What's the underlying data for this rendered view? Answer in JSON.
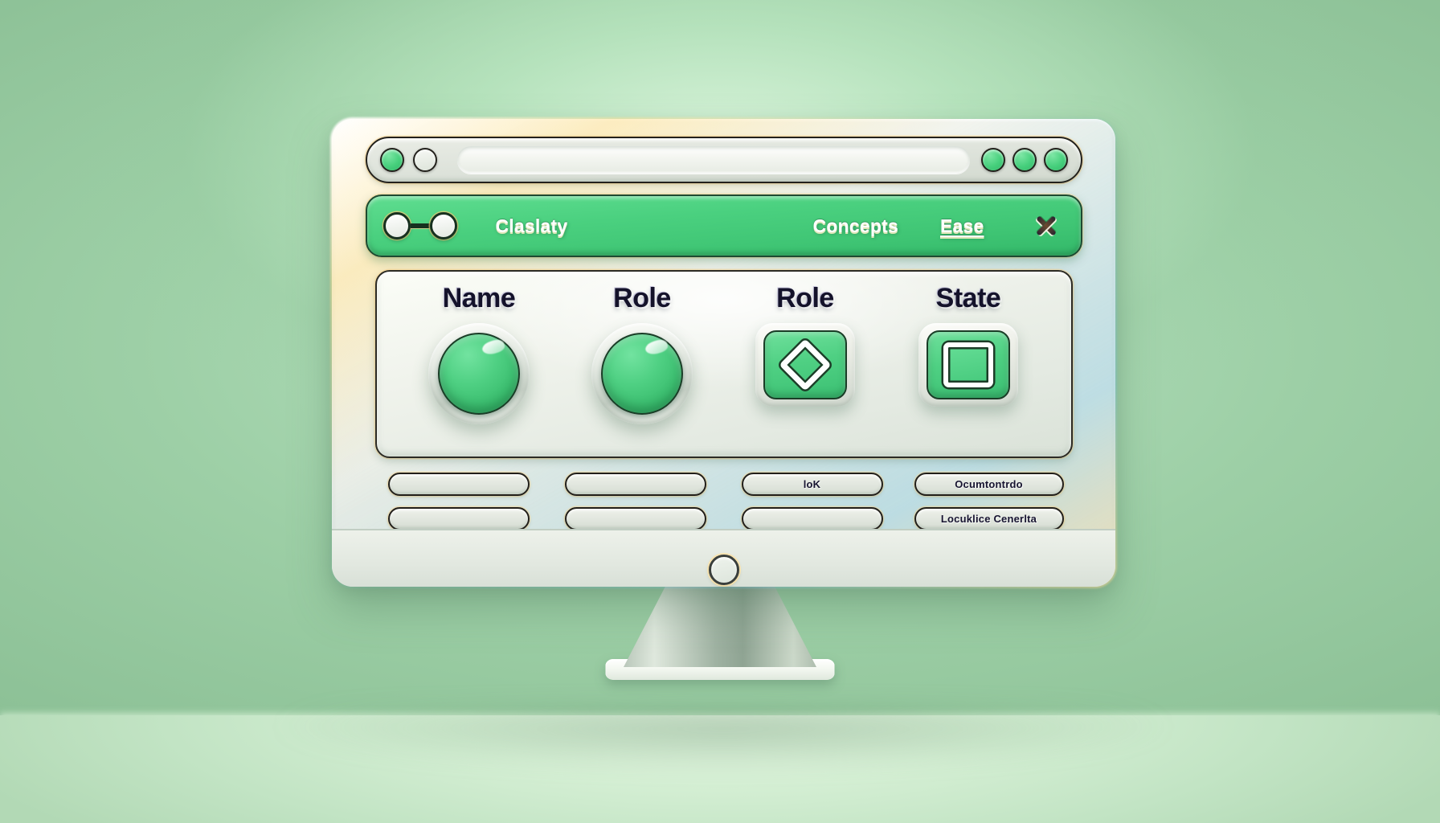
{
  "scene": {
    "description": "3D render of a desktop monitor displaying an app window",
    "background_color": "#9dcfa6",
    "monitor_body_color": "#f0f3ec",
    "accent_green": "#4bd07f"
  },
  "titlebar": {
    "left_dots": [
      {
        "name": "traffic-dot-green",
        "state": "filled"
      },
      {
        "name": "traffic-dot-empty",
        "state": "empty"
      }
    ],
    "url_value": "",
    "url_placeholder": "",
    "right_dots": [
      {
        "name": "chrome-dot-1",
        "state": "filled"
      },
      {
        "name": "chrome-dot-2",
        "state": "filled"
      },
      {
        "name": "chrome-dot-3",
        "state": "filled"
      }
    ]
  },
  "toolbar": {
    "link_icon": "link-icon",
    "primary_label": "Claslaty",
    "concepts_label": "Concepts",
    "ease_label": "Ease",
    "close_icon": "close-icon",
    "bar_color": "#4ad07f"
  },
  "card": {
    "columns": [
      {
        "header": "Name",
        "widget": {
          "type": "round-button",
          "name": "name-round-button",
          "color": "#4fd083"
        }
      },
      {
        "header": "Role",
        "widget": {
          "type": "round-button",
          "name": "role-round-button",
          "color": "#4fd083"
        }
      },
      {
        "header": "Role",
        "widget": {
          "type": "tile-diamond",
          "name": "role-diamond-tile",
          "color": "#4fd083"
        }
      },
      {
        "header": "State",
        "widget": {
          "type": "tile-square",
          "name": "state-square-tile",
          "color": "#4fd083"
        }
      }
    ]
  },
  "pills": {
    "rows": [
      [
        {
          "text": ""
        },
        {
          "text": ""
        },
        {
          "text": "loK"
        },
        {
          "text": "Ocumtontrdo"
        }
      ],
      [
        {
          "text": ""
        },
        {
          "text": ""
        },
        {
          "text": ""
        },
        {
          "text": "Locuklice Cenerlta"
        }
      ]
    ]
  },
  "monitor": {
    "power_indicator": "power-ring-icon",
    "stand": "monitor-stand",
    "base": "monitor-base"
  }
}
